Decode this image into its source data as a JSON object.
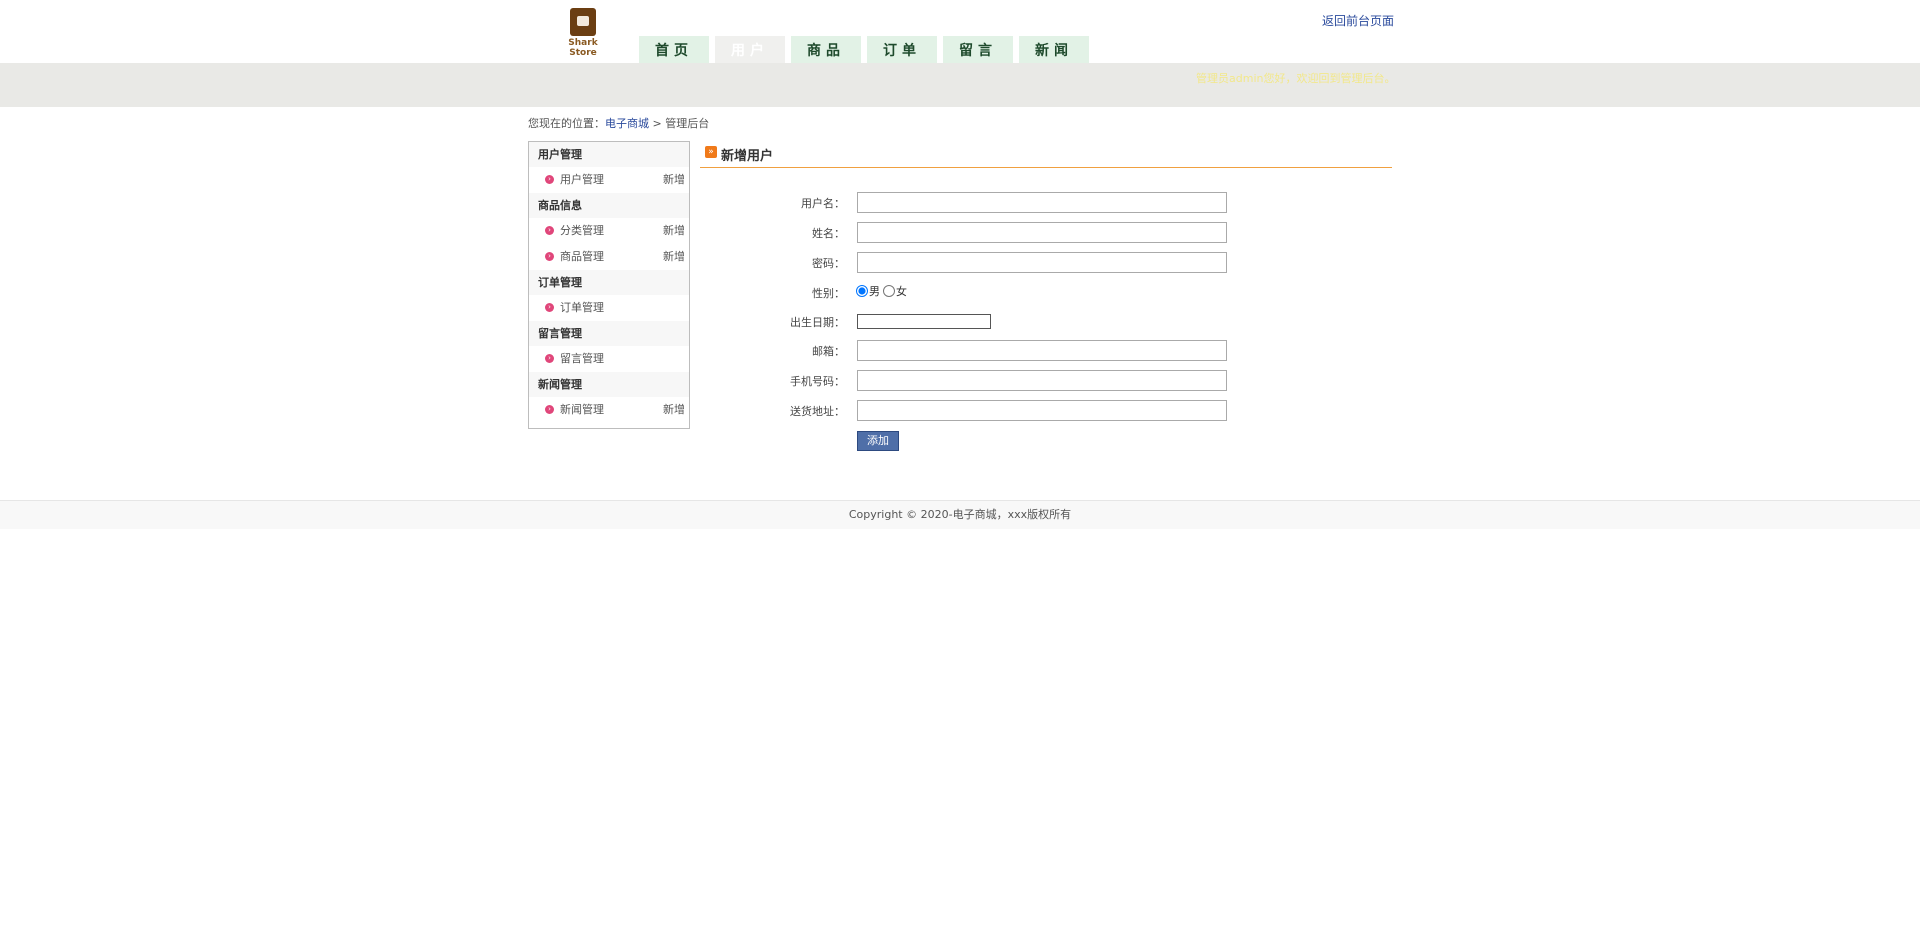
{
  "header": {
    "logo_text": "Shark Store",
    "nav": [
      "首页",
      "用户",
      "商品",
      "订单",
      "留言",
      "新闻"
    ],
    "active_nav": "用户",
    "back_link": "返回前台页面",
    "welcome": "管理员admin您好，欢迎回到管理后台。"
  },
  "breadcrumb": {
    "prefix": "您现在的位置：",
    "link": "电子商城",
    "sep": " > ",
    "current": "管理后台"
  },
  "sidebar": {
    "sections": [
      {
        "title": "用户管理",
        "items": [
          {
            "label": "用户管理",
            "add": "新增"
          }
        ]
      },
      {
        "title": "商品信息",
        "items": [
          {
            "label": "分类管理",
            "add": "新增"
          },
          {
            "label": "商品管理",
            "add": "新增"
          }
        ]
      },
      {
        "title": "订单管理",
        "items": [
          {
            "label": "订单管理",
            "add": ""
          }
        ]
      },
      {
        "title": "留言管理",
        "items": [
          {
            "label": "留言管理",
            "add": ""
          }
        ]
      },
      {
        "title": "新闻管理",
        "items": [
          {
            "label": "新闻管理",
            "add": "新增"
          }
        ]
      }
    ]
  },
  "form": {
    "title": "新增用户",
    "fields": {
      "username": {
        "label": "用户名：",
        "value": ""
      },
      "name": {
        "label": "姓名：",
        "value": ""
      },
      "password": {
        "label": "密码：",
        "value": ""
      },
      "gender": {
        "label": "性别：",
        "options": [
          "男",
          "女"
        ],
        "selected": "男"
      },
      "birthday": {
        "label": "出生日期：",
        "value": ""
      },
      "email": {
        "label": "邮箱：",
        "value": ""
      },
      "phone": {
        "label": "手机号码：",
        "value": ""
      },
      "address": {
        "label": "送货地址：",
        "value": ""
      }
    },
    "submit_label": "添加"
  },
  "footer": {
    "copyright": "Copyright © 2020-电子商城，xxx版权所有"
  },
  "colors": {
    "accent_orange": "#f0a040",
    "nav_bg": "#e2f2e6",
    "button_blue": "#4f6fa8"
  }
}
